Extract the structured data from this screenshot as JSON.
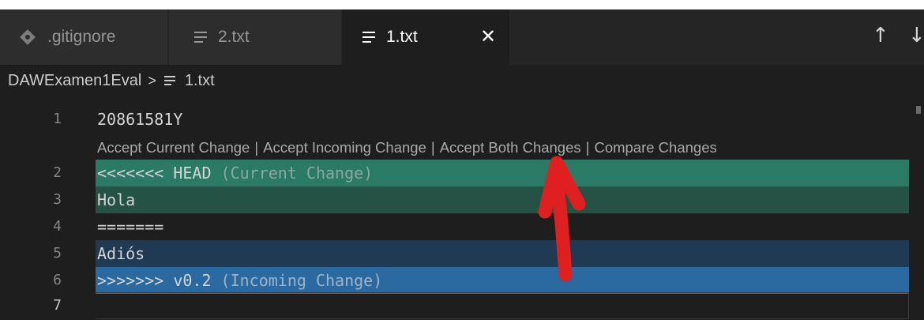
{
  "tabs": [
    {
      "label": ".gitignore",
      "icon": "git-diamond-icon",
      "active": false
    },
    {
      "label": "2.txt",
      "icon": "text-file-icon",
      "active": false
    },
    {
      "label": "1.txt",
      "icon": "text-file-icon",
      "active": true
    }
  ],
  "tab_close_glyph": "✕",
  "nav": {
    "up": "↑",
    "down": "↓"
  },
  "breadcrumb": {
    "folder": "DAWExamen1Eval",
    "separator": ">",
    "file": "1.txt"
  },
  "codelens": {
    "accept_current": "Accept Current Change",
    "accept_incoming": "Accept Incoming Change",
    "accept_both": "Accept Both Changes",
    "compare": "Compare Changes",
    "divider": "|"
  },
  "lines": [
    {
      "number": "1",
      "text": "20861581Y"
    },
    {
      "number": "2",
      "marker": "<<<<<<< HEAD",
      "annotation": "(Current Change)"
    },
    {
      "number": "3",
      "text": "Hola"
    },
    {
      "number": "4",
      "text": "======="
    },
    {
      "number": "5",
      "text": "Adiós"
    },
    {
      "number": "6",
      "marker": ">>>>>>> v0.2",
      "annotation": "(Incoming Change)"
    },
    {
      "number": "7",
      "text": ""
    }
  ],
  "colors": {
    "current_header": "#2a7a65",
    "current_body": "#245244",
    "incoming_body": "#213a53",
    "incoming_header": "#2b6aa0",
    "annotation_arrow": "#e02020"
  }
}
